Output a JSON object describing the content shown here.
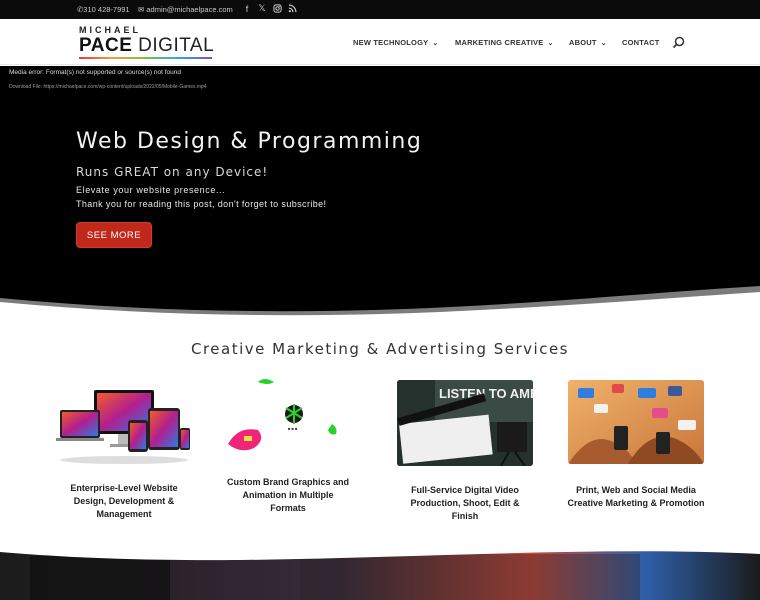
{
  "topbar": {
    "phone": "310 428-7991",
    "email": "admin@michaelpace.com",
    "social": [
      "facebook-icon",
      "x-icon",
      "instagram-icon",
      "rss-icon"
    ]
  },
  "header": {
    "logo_line1": "MICHAEL",
    "logo_line2a": "PACE",
    "logo_line2b": "DIGITAL",
    "nav": [
      {
        "label": "NEW TECHNOLOGY"
      },
      {
        "label": "MARKETING CREATIVE"
      },
      {
        "label": "ABOUT"
      },
      {
        "label": "CONTACT"
      }
    ]
  },
  "hero": {
    "media_error": "Media error: Format(s) not supported or source(s) not found",
    "download": "Download File: https://michaelpace.com/wp-content/uploads/2022/05/Mobile-Games.mp4",
    "title": "Web Design & Programming",
    "subtitle": "Runs GREAT on any Device!",
    "line1": "Elevate your website presence...",
    "line2": "Thank you for reading this post, don't forget to subscribe!",
    "cta": "SEE MORE"
  },
  "services": {
    "heading": "Creative Marketing & Advertising Services",
    "items": [
      {
        "title_l1": "Enterprise-Level Website",
        "title_l2": "Design, Development &",
        "title_l3": "Management"
      },
      {
        "title_l1": "Custom Brand Graphics and",
        "title_l2": "Animation in Multiple Formats"
      },
      {
        "title_l1": "Full-Service Digital Video",
        "title_l2": "Production, Shoot, Edit & Finish"
      },
      {
        "title_l1": "Print, Web and Social Media",
        "title_l2": "Creative Marketing & Promotion"
      }
    ]
  },
  "colors": {
    "accent_red": "#c0281b",
    "hero_bg": "#000000",
    "topbar_bg": "#0b0b0b"
  }
}
